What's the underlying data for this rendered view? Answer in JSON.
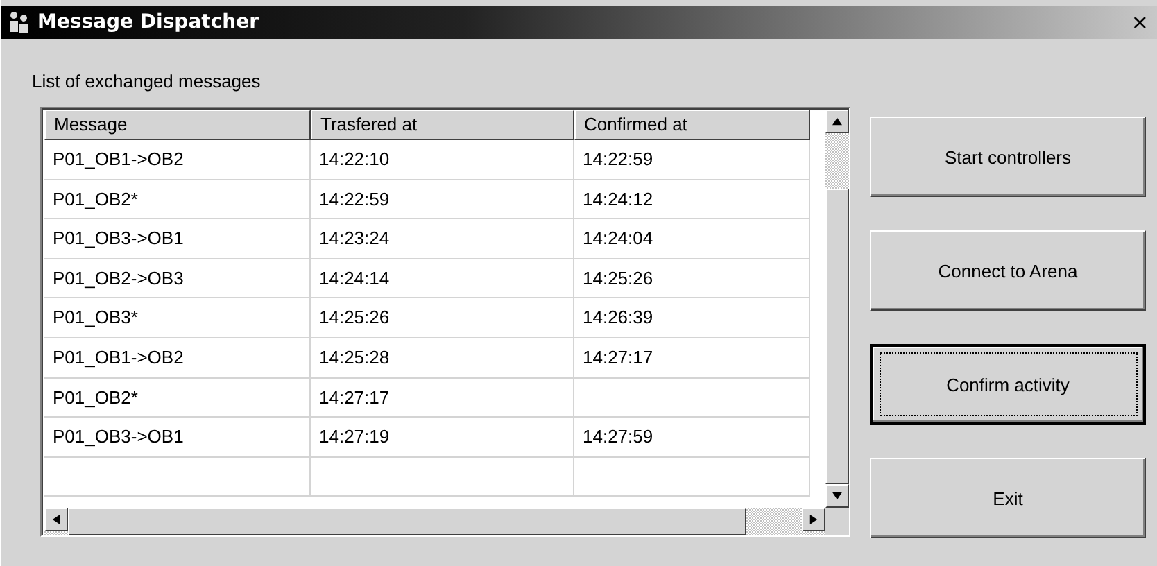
{
  "window": {
    "title": "Message Dispatcher",
    "close": "×"
  },
  "list_label": "List of exchanged messages",
  "table": {
    "columns": [
      "Message",
      "Trasfered at",
      "Confirmed at"
    ],
    "rows": [
      [
        "P01_OB1->OB2",
        "14:22:10",
        "14:22:59"
      ],
      [
        "P01_OB2*",
        "14:22:59",
        "14:24:12"
      ],
      [
        "P01_OB3->OB1",
        "14:23:24",
        "14:24:04"
      ],
      [
        "P01_OB2->OB3",
        "14:24:14",
        "14:25:26"
      ],
      [
        "P01_OB3*",
        "14:25:26",
        "14:26:39"
      ],
      [
        "P01_OB1->OB2",
        "14:25:28",
        "14:27:17"
      ],
      [
        "P01_OB2*",
        "14:27:17",
        ""
      ],
      [
        "P01_OB3->OB1",
        "14:27:19",
        "14:27:59"
      ],
      [
        "",
        "",
        ""
      ]
    ]
  },
  "buttons": [
    {
      "label": "Start controllers",
      "focused": false
    },
    {
      "label": "Connect to Arena",
      "focused": false
    },
    {
      "label": "Confirm activity",
      "focused": true
    },
    {
      "label": "Exit",
      "focused": false
    }
  ]
}
